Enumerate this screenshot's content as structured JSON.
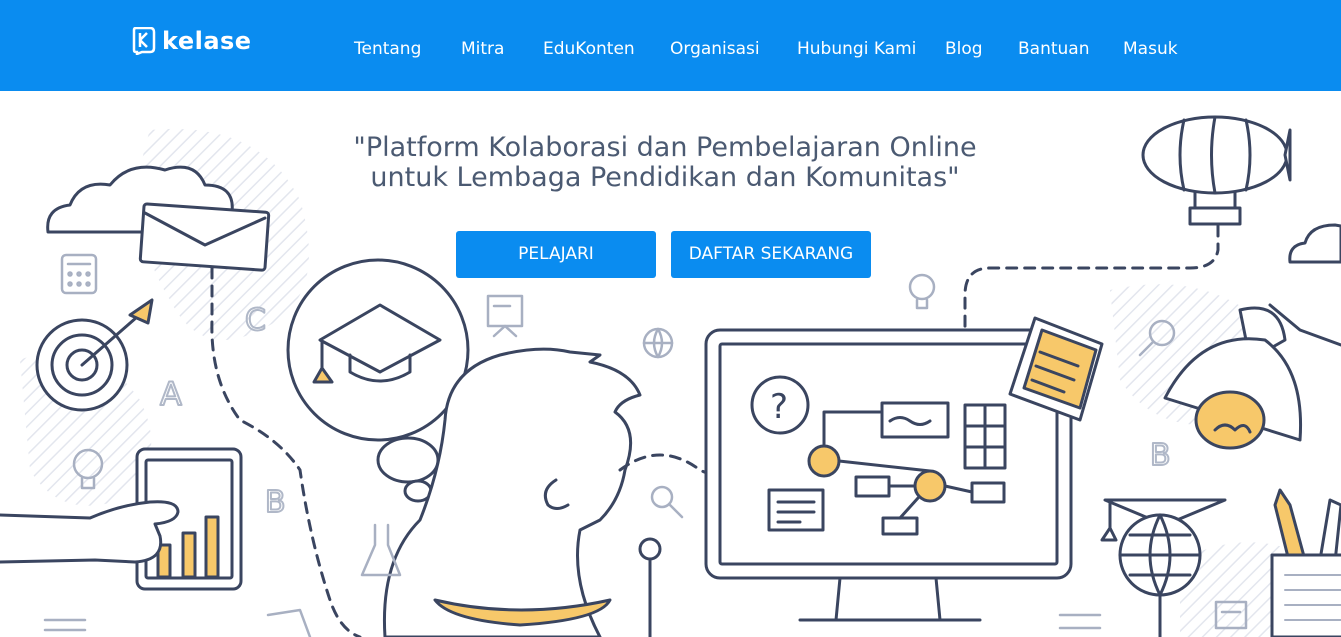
{
  "brand": {
    "name": "kelase"
  },
  "nav": {
    "items": [
      {
        "label": "Tentang"
      },
      {
        "label": "Mitra"
      },
      {
        "label": "EduKonten"
      },
      {
        "label": "Organisasi"
      },
      {
        "label": "Hubungi Kami"
      },
      {
        "label": "Blog"
      },
      {
        "label": "Bantuan"
      },
      {
        "label": "Masuk"
      }
    ]
  },
  "hero": {
    "tagline_line1": "\"Platform Kolaborasi dan Pembelajaran Online",
    "tagline_line2": "untuk Lembaga Pendidikan dan Komunitas\"",
    "primary_button": "PELAJARI",
    "secondary_button": "DAFTAR SEKARANG"
  },
  "colors": {
    "accent": "#0a8cf0",
    "line_art": "#3a4560",
    "highlight": "#f7c86a"
  },
  "icons": [
    "kelase-logo-icon",
    "cloud-icon",
    "envelope-icon",
    "target-icon",
    "calculator-icon",
    "graduation-cap-icon",
    "tablet-chart-icon",
    "hand-icon",
    "airship-icon",
    "monitor-icon",
    "sticky-note-icon",
    "desk-lamp-icon",
    "globe-icon",
    "pencil-cup-icon",
    "lightbulb-icon",
    "magnifier-icon",
    "flask-icon",
    "book-icon"
  ]
}
